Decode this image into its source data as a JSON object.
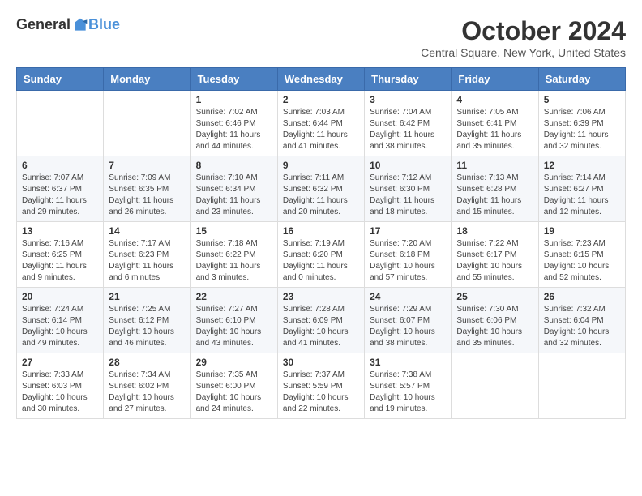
{
  "logo": {
    "general": "General",
    "blue": "Blue"
  },
  "header": {
    "month": "October 2024",
    "location": "Central Square, New York, United States"
  },
  "weekdays": [
    "Sunday",
    "Monday",
    "Tuesday",
    "Wednesday",
    "Thursday",
    "Friday",
    "Saturday"
  ],
  "weeks": [
    [
      {
        "day": "",
        "info": ""
      },
      {
        "day": "",
        "info": ""
      },
      {
        "day": "1",
        "info": "Sunrise: 7:02 AM\nSunset: 6:46 PM\nDaylight: 11 hours and 44 minutes."
      },
      {
        "day": "2",
        "info": "Sunrise: 7:03 AM\nSunset: 6:44 PM\nDaylight: 11 hours and 41 minutes."
      },
      {
        "day": "3",
        "info": "Sunrise: 7:04 AM\nSunset: 6:42 PM\nDaylight: 11 hours and 38 minutes."
      },
      {
        "day": "4",
        "info": "Sunrise: 7:05 AM\nSunset: 6:41 PM\nDaylight: 11 hours and 35 minutes."
      },
      {
        "day": "5",
        "info": "Sunrise: 7:06 AM\nSunset: 6:39 PM\nDaylight: 11 hours and 32 minutes."
      }
    ],
    [
      {
        "day": "6",
        "info": "Sunrise: 7:07 AM\nSunset: 6:37 PM\nDaylight: 11 hours and 29 minutes."
      },
      {
        "day": "7",
        "info": "Sunrise: 7:09 AM\nSunset: 6:35 PM\nDaylight: 11 hours and 26 minutes."
      },
      {
        "day": "8",
        "info": "Sunrise: 7:10 AM\nSunset: 6:34 PM\nDaylight: 11 hours and 23 minutes."
      },
      {
        "day": "9",
        "info": "Sunrise: 7:11 AM\nSunset: 6:32 PM\nDaylight: 11 hours and 20 minutes."
      },
      {
        "day": "10",
        "info": "Sunrise: 7:12 AM\nSunset: 6:30 PM\nDaylight: 11 hours and 18 minutes."
      },
      {
        "day": "11",
        "info": "Sunrise: 7:13 AM\nSunset: 6:28 PM\nDaylight: 11 hours and 15 minutes."
      },
      {
        "day": "12",
        "info": "Sunrise: 7:14 AM\nSunset: 6:27 PM\nDaylight: 11 hours and 12 minutes."
      }
    ],
    [
      {
        "day": "13",
        "info": "Sunrise: 7:16 AM\nSunset: 6:25 PM\nDaylight: 11 hours and 9 minutes."
      },
      {
        "day": "14",
        "info": "Sunrise: 7:17 AM\nSunset: 6:23 PM\nDaylight: 11 hours and 6 minutes."
      },
      {
        "day": "15",
        "info": "Sunrise: 7:18 AM\nSunset: 6:22 PM\nDaylight: 11 hours and 3 minutes."
      },
      {
        "day": "16",
        "info": "Sunrise: 7:19 AM\nSunset: 6:20 PM\nDaylight: 11 hours and 0 minutes."
      },
      {
        "day": "17",
        "info": "Sunrise: 7:20 AM\nSunset: 6:18 PM\nDaylight: 10 hours and 57 minutes."
      },
      {
        "day": "18",
        "info": "Sunrise: 7:22 AM\nSunset: 6:17 PM\nDaylight: 10 hours and 55 minutes."
      },
      {
        "day": "19",
        "info": "Sunrise: 7:23 AM\nSunset: 6:15 PM\nDaylight: 10 hours and 52 minutes."
      }
    ],
    [
      {
        "day": "20",
        "info": "Sunrise: 7:24 AM\nSunset: 6:14 PM\nDaylight: 10 hours and 49 minutes."
      },
      {
        "day": "21",
        "info": "Sunrise: 7:25 AM\nSunset: 6:12 PM\nDaylight: 10 hours and 46 minutes."
      },
      {
        "day": "22",
        "info": "Sunrise: 7:27 AM\nSunset: 6:10 PM\nDaylight: 10 hours and 43 minutes."
      },
      {
        "day": "23",
        "info": "Sunrise: 7:28 AM\nSunset: 6:09 PM\nDaylight: 10 hours and 41 minutes."
      },
      {
        "day": "24",
        "info": "Sunrise: 7:29 AM\nSunset: 6:07 PM\nDaylight: 10 hours and 38 minutes."
      },
      {
        "day": "25",
        "info": "Sunrise: 7:30 AM\nSunset: 6:06 PM\nDaylight: 10 hours and 35 minutes."
      },
      {
        "day": "26",
        "info": "Sunrise: 7:32 AM\nSunset: 6:04 PM\nDaylight: 10 hours and 32 minutes."
      }
    ],
    [
      {
        "day": "27",
        "info": "Sunrise: 7:33 AM\nSunset: 6:03 PM\nDaylight: 10 hours and 30 minutes."
      },
      {
        "day": "28",
        "info": "Sunrise: 7:34 AM\nSunset: 6:02 PM\nDaylight: 10 hours and 27 minutes."
      },
      {
        "day": "29",
        "info": "Sunrise: 7:35 AM\nSunset: 6:00 PM\nDaylight: 10 hours and 24 minutes."
      },
      {
        "day": "30",
        "info": "Sunrise: 7:37 AM\nSunset: 5:59 PM\nDaylight: 10 hours and 22 minutes."
      },
      {
        "day": "31",
        "info": "Sunrise: 7:38 AM\nSunset: 5:57 PM\nDaylight: 10 hours and 19 minutes."
      },
      {
        "day": "",
        "info": ""
      },
      {
        "day": "",
        "info": ""
      }
    ]
  ]
}
